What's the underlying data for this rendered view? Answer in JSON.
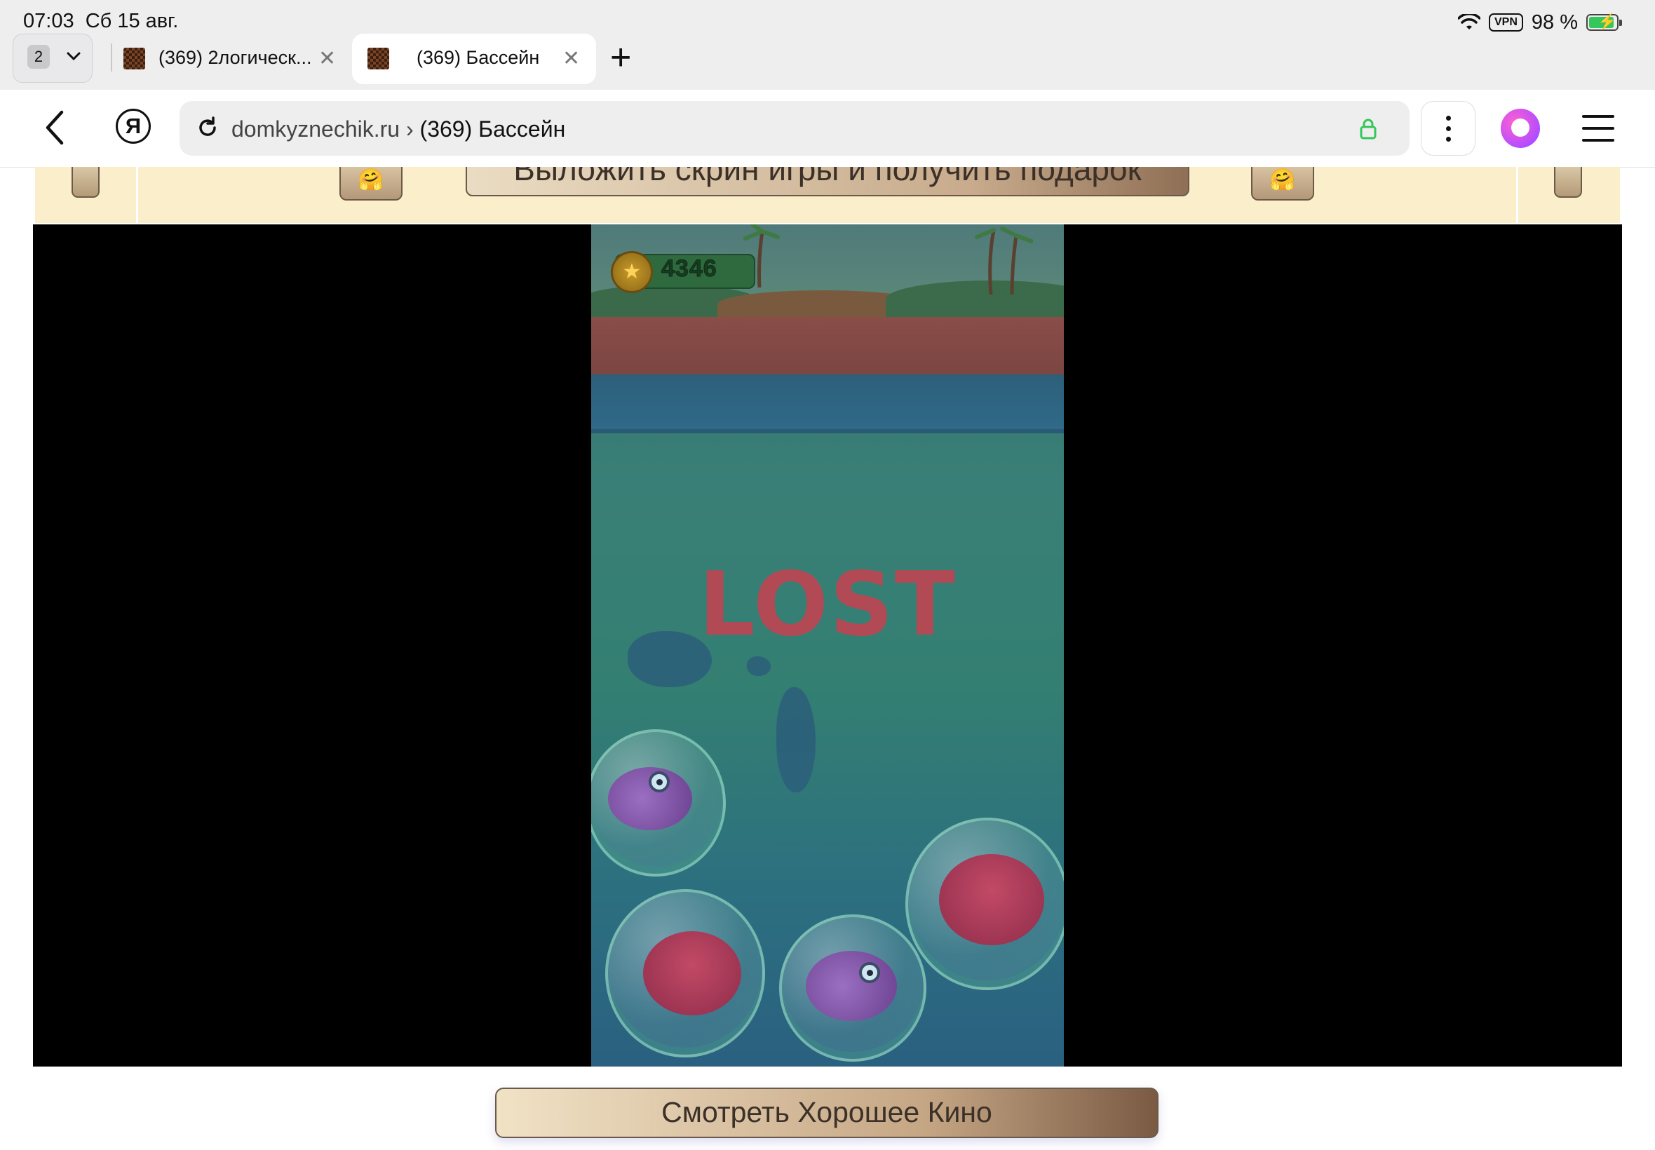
{
  "status": {
    "time": "07:03",
    "date": "Сб 15 авг.",
    "vpn": "VPN",
    "battery": "98 %",
    "icons": [
      "wifi-icon",
      "battery-charging-icon"
    ]
  },
  "tabs": {
    "count": "2",
    "items": [
      {
        "title": "(369) 2логическ...",
        "active": false
      },
      {
        "title": "(369) Бассейн",
        "active": true
      }
    ],
    "new_tab": "+"
  },
  "toolbar": {
    "domain": "domkyznechik.ru",
    "separator": "›",
    "page_title": "(369) Бассейн",
    "accent": "#34c759"
  },
  "banner": {
    "gift_label": "Выложить скрин игры и получить подарок",
    "emoji": "🤗"
  },
  "game": {
    "score": "4346",
    "status_text": "LOST"
  },
  "footer": {
    "watch_label": "Смотреть Хорошее Кино"
  }
}
